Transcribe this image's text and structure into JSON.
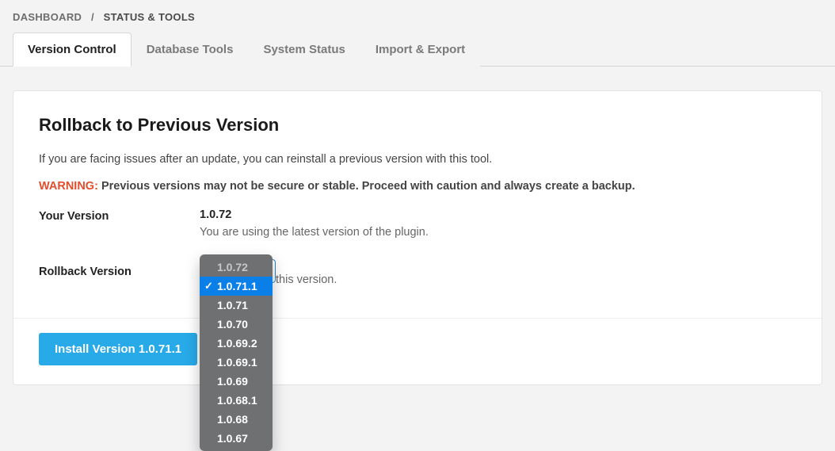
{
  "breadcrumb": {
    "root": "DASHBOARD",
    "sep": "/",
    "current": "STATUS & TOOLS"
  },
  "tabs": [
    {
      "label": "Version Control"
    },
    {
      "label": "Database Tools"
    },
    {
      "label": "System Status"
    },
    {
      "label": "Import & Export"
    }
  ],
  "section": {
    "title": "Rollback to Previous Version",
    "intro": "If you are facing issues after an update, you can reinstall a previous version with this tool.",
    "warning_prefix": "WARNING:",
    "warning_text": " Previous versions may not be secure or stable. Proceed with caution and always create a backup."
  },
  "your_version": {
    "label": "Your Version",
    "value": "1.0.72",
    "note": "You are using the latest version of the plugin."
  },
  "rollback": {
    "label": "Rollback Version",
    "note_tail": "this version.",
    "options": [
      {
        "v": "1.0.72",
        "disabled": true
      },
      {
        "v": "1.0.71.1",
        "selected": true
      },
      {
        "v": "1.0.71"
      },
      {
        "v": "1.0.70"
      },
      {
        "v": "1.0.69.2"
      },
      {
        "v": "1.0.69.1"
      },
      {
        "v": "1.0.69"
      },
      {
        "v": "1.0.68.1"
      },
      {
        "v": "1.0.68"
      },
      {
        "v": "1.0.67"
      }
    ]
  },
  "install_button": "Install Version 1.0.71.1"
}
